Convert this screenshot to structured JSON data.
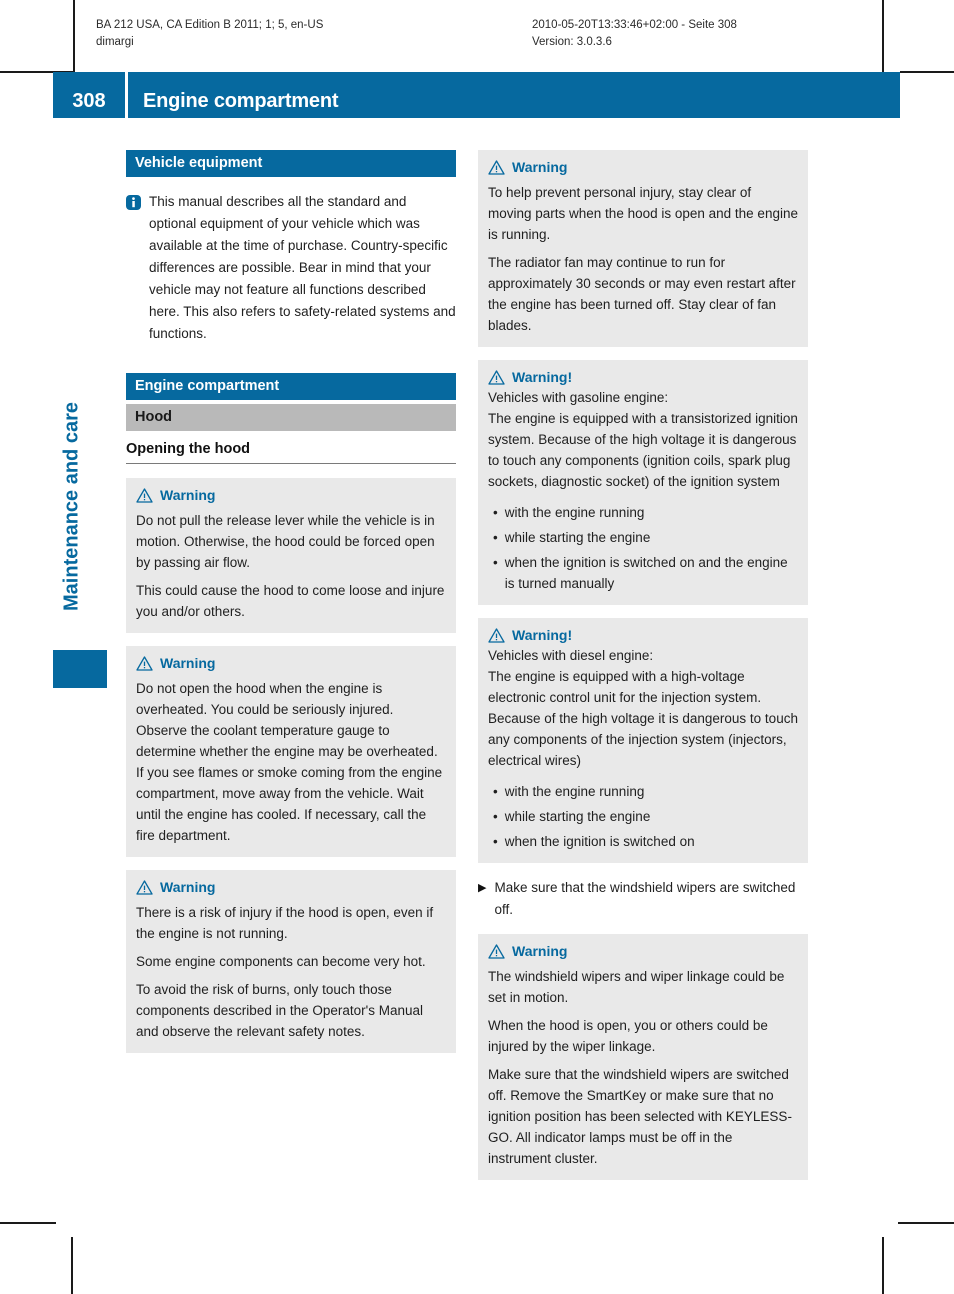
{
  "colors": {
    "brand_blue": "#06699F",
    "gray_heading": "#b9b9b9",
    "warn_box_bg": "#e9e9e9",
    "text": "#1f1f1f"
  },
  "print_slug": {
    "left": "BA 212 USA, CA Edition B 2011; 1; 5, en-US\ndimargi",
    "right": "2010-05-20T13:33:46+02:00 - Seite 308\nVersion: 3.0.3.6"
  },
  "header": {
    "page_number": "308",
    "title": "Engine compartment"
  },
  "sidebar": {
    "chapter": "Maintenance and care"
  },
  "left_column": {
    "vehicle_equipment_heading": "Vehicle equipment",
    "vehicle_equipment_note": "This manual describes all the standard and optional equipment of your vehicle which was available at the time of purchase. Country-specific differences are possible. Bear in mind that your vehicle may not feature all functions described here. This also refers to safety-related systems and functions.",
    "engine_compartment_heading": "Engine compartment",
    "hood_heading": "Hood",
    "opening_the_hood_heading": "Opening the hood",
    "warnings": [
      {
        "label": "Warning",
        "paragraphs": [
          "Do not pull the release lever while the vehicle is in motion. Otherwise, the hood could be forced open by passing air flow.",
          "This could cause the hood to come loose and injure you and/or others."
        ]
      },
      {
        "label": "Warning",
        "paragraphs": [
          "Do not open the hood when the engine is overheated. You could be seriously injured. Observe the coolant temperature gauge to determine whether the engine may be overheated. If you see flames or smoke coming from the engine compartment, move away from the vehicle. Wait until the engine has cooled. If necessary, call the fire department."
        ]
      },
      {
        "label": "Warning",
        "paragraphs": [
          "There is a risk of injury if the hood is open, even if the engine is not running.",
          "Some engine components can become very hot.",
          "To avoid the risk of burns, only touch those components described in the Operator's Manual and observe the relevant safety notes."
        ]
      }
    ]
  },
  "right_column": {
    "warning_1": {
      "label": "Warning",
      "paragraphs": [
        "To help prevent personal injury, stay clear of moving parts when the hood is open and the engine is running.",
        "The radiator fan may continue to run for approximately 30 seconds or may even restart after the engine has been turned off. Stay clear of fan blades."
      ]
    },
    "warning_2": {
      "label": "Warning!",
      "paragraphs": [
        "Vehicles with gasoline engine:",
        "The engine is equipped with a transistorized ignition system. Because of the high voltage it is dangerous to touch any components (ignition coils, spark plug sockets, diagnostic socket) of the ignition system"
      ],
      "bullets": [
        "with the engine running",
        "while starting the engine",
        "when the ignition is switched on and the engine is turned manually"
      ]
    },
    "warning_3": {
      "label": "Warning!",
      "paragraphs": [
        "Vehicles with diesel engine:",
        "The engine is equipped with a high-voltage electronic control unit for the injection system. Because of the high voltage it is dangerous to touch any components of the injection system (injectors, electrical wires)"
      ],
      "bullets": [
        "with the engine running",
        "while starting the engine",
        "when the ignition is switched on"
      ]
    },
    "step": "Make sure that the windshield wipers are switched off.",
    "warning_4": {
      "label": "Warning",
      "paragraphs": [
        "The windshield wipers and wiper linkage could be set in motion.",
        "When the hood is open, you or others could be injured by the wiper linkage.",
        "Make sure that the windshield wipers are switched off. Remove the SmartKey or make sure that no ignition position has been selected with KEYLESS-GO. All indicator lamps must be off in the instrument cluster."
      ]
    }
  },
  "glyphs": {
    "bullet": "•",
    "step_arrow": "▶"
  }
}
